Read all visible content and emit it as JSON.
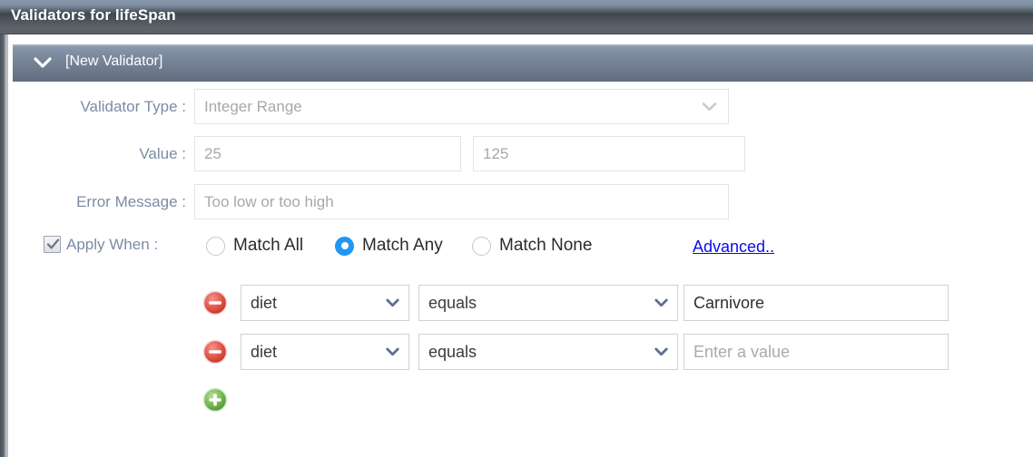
{
  "window": {
    "title": "Validators for lifeSpan"
  },
  "panel": {
    "chevron_icon": "chevron-down-icon",
    "title": "[New Validator]"
  },
  "form": {
    "validator_type": {
      "label": "Validator Type :",
      "value": "Integer Range",
      "chevron_icon": "chevron-down-icon"
    },
    "value": {
      "label": "Value :",
      "min": "25",
      "max": "125"
    },
    "error_message": {
      "label": "Error Message :",
      "value": "Too low or too high"
    },
    "apply_when": {
      "label": "Apply When :",
      "checked": true,
      "checkbox_icon": "check-icon",
      "options": [
        {
          "label": "Match All",
          "selected": false
        },
        {
          "label": "Match Any",
          "selected": true
        },
        {
          "label": "Match None",
          "selected": false
        }
      ],
      "advanced_link": "Advanced.."
    },
    "conditions": {
      "remove_icon": "minus-circle-icon",
      "add_icon": "plus-circle-icon",
      "rows": [
        {
          "field": "diet",
          "operator": "equals",
          "value": "Carnivore",
          "value_is_placeholder": false
        },
        {
          "field": "diet",
          "operator": "equals",
          "value": "Enter a value",
          "value_is_placeholder": true
        }
      ]
    }
  },
  "colors": {
    "titlebar_dark": "#3f474e",
    "panel_header": "#707d90",
    "label_text": "#7b8ca4",
    "link_blue": "#0b0bf0",
    "radio_selected": "#2196f3",
    "remove_red": "#e04a3f",
    "add_green": "#6ab04c"
  }
}
